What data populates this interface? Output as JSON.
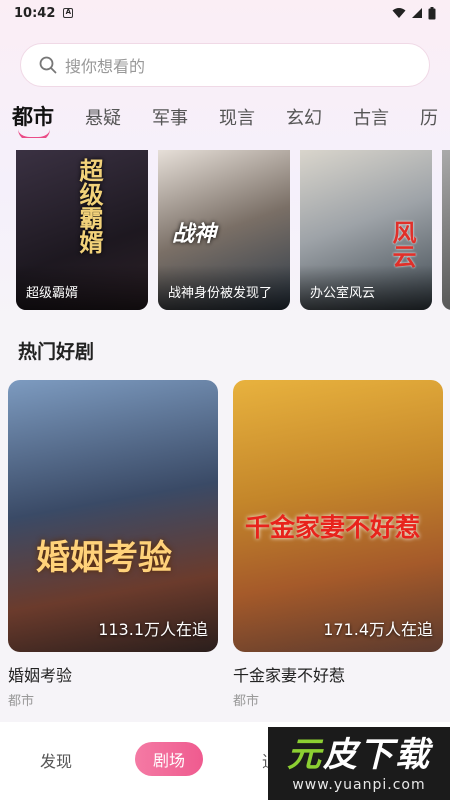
{
  "status_bar": {
    "time": "10:42",
    "notif_glyph": "A"
  },
  "search": {
    "placeholder": "搜你想看的"
  },
  "tabs": [
    {
      "label": "都市",
      "active": true
    },
    {
      "label": "悬疑"
    },
    {
      "label": "军事"
    },
    {
      "label": "现言"
    },
    {
      "label": "玄幻"
    },
    {
      "label": "古言"
    },
    {
      "label": "历"
    }
  ],
  "banners": [
    {
      "title": "超级霸婿",
      "art_text": "超级霸婿"
    },
    {
      "title": "战神身份被发现了",
      "art_text": "战神"
    },
    {
      "title": "办公室风云",
      "art_text": "风云"
    }
  ],
  "section": {
    "title": "热门好剧"
  },
  "cards": [
    {
      "name": "婚姻考验",
      "genre": "都市",
      "watching": "113.1万人在追",
      "poster_text": "婚姻考验"
    },
    {
      "name": "千金家妻不好惹",
      "genre": "都市",
      "watching": "171.4万人在追",
      "poster_text": "千金家妻不好惹"
    }
  ],
  "bottom_nav": [
    {
      "label": "发现"
    },
    {
      "label": "剧场",
      "active": true
    },
    {
      "label": "追"
    }
  ],
  "watermark": {
    "main_1": "元",
    "main_2": "皮下载",
    "url": "www.yuanpi.com"
  },
  "colors": {
    "accent": "#ea4c87",
    "nav_active": "#ef5b8f"
  }
}
